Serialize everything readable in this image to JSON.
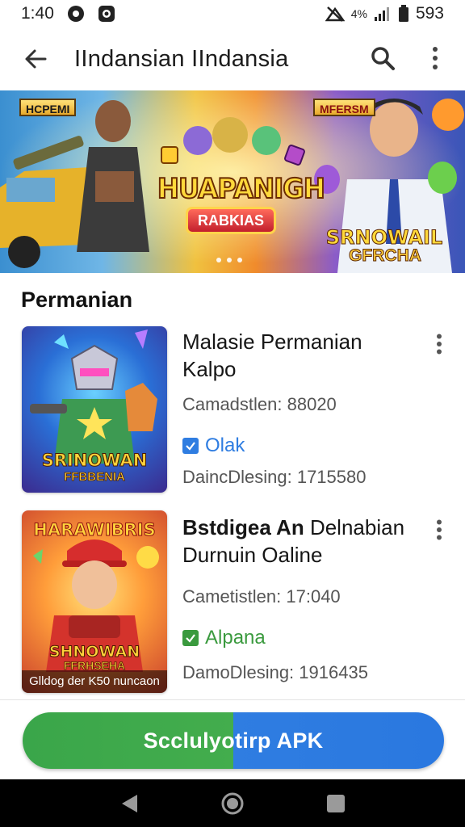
{
  "status_bar": {
    "time": "1:40",
    "network_small": "4%",
    "battery": "593"
  },
  "app_bar": {
    "title": "IIndansian IIndansia"
  },
  "banner": {
    "tag_left": "HCPEMI",
    "tag_right": "MFERSM",
    "headline": "HUAPANIGH",
    "badge": "RABKIAS",
    "right_title": "SRNOWAIL",
    "right_sub": "GFRCHA",
    "dot_count": 3
  },
  "section": {
    "title": "Permanian"
  },
  "games": [
    {
      "name_line1": "Malasie Permanian",
      "name_line2": "Kalpo",
      "meta": "Camadstlen:  88020",
      "status": "Olak",
      "status_color": "#2f7de1",
      "downloads": "DaincDlesing: 1715580",
      "thumb_title": "SRINOWAN",
      "thumb_sub": "FFBBENIA"
    },
    {
      "name_bold": "Bstdigea An",
      "name_rest": " Delnabian",
      "name_line2": "Durnuin  Oaline",
      "meta": "Cametistlen: 17:040",
      "status": "Alpana",
      "status_color": "#3a9a3e",
      "downloads": "DamoDlesing: 1916435",
      "thumb_top": "HARAWIBRIS",
      "thumb_title": "SHNOWAN",
      "thumb_sub": "FFRHSEHA",
      "thumb_caption": "Glldog der K50 nuncaon"
    }
  ],
  "download_button": {
    "label": "Scclulyotirp APK"
  }
}
